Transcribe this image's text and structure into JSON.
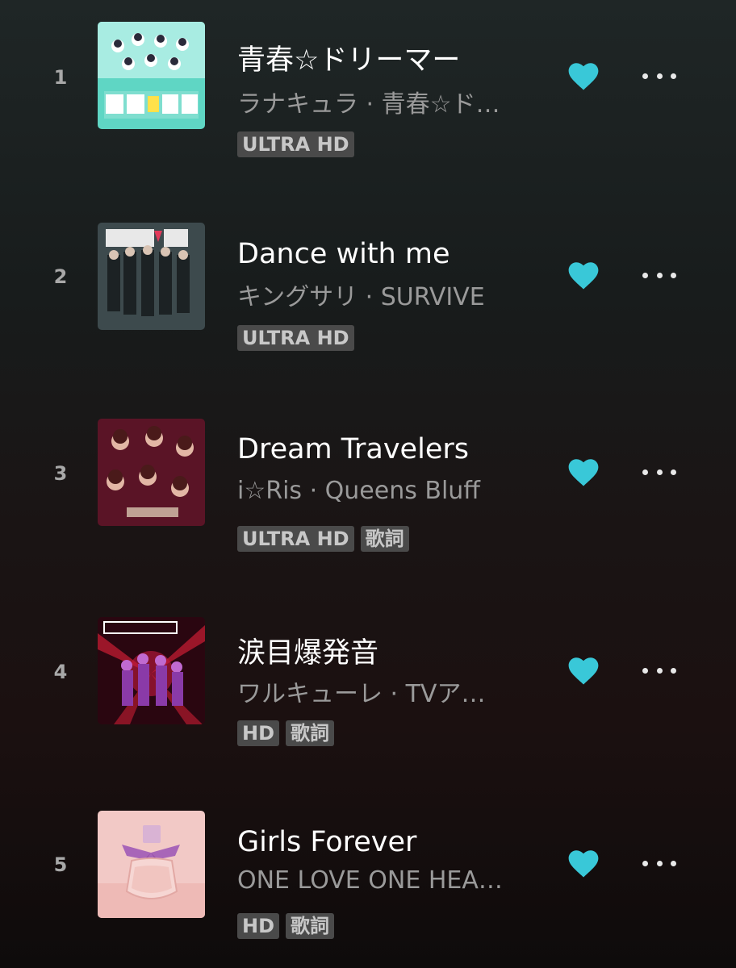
{
  "tracks": [
    {
      "number": "1",
      "title": "青春☆ドリーマー",
      "subtitle": "ラナキュラ · 青春☆ド…",
      "badges": [
        "ULTRA HD"
      ],
      "cover": "cover-art-seishun-dreamer",
      "liked": true
    },
    {
      "number": "2",
      "title": "Dance with me",
      "subtitle": "キングサリ · SURVIVE",
      "badges": [
        "ULTRA HD"
      ],
      "cover": "cover-art-survive",
      "liked": true
    },
    {
      "number": "3",
      "title": "Dream Travelers",
      "subtitle": "i☆Ris · Queens Bluff",
      "badges": [
        "ULTRA HD",
        "歌詞"
      ],
      "cover": "cover-art-queens-bluff",
      "liked": true
    },
    {
      "number": "4",
      "title": "涙目爆発音",
      "subtitle": "ワルキューレ · TVア…",
      "badges": [
        "HD",
        "歌詞"
      ],
      "cover": "cover-art-walkure",
      "liked": true
    },
    {
      "number": "5",
      "title": "Girls Forever",
      "subtitle": "ONE LOVE ONE HEA…",
      "badges": [
        "HD",
        "歌詞"
      ],
      "cover": "cover-art-girls-forever",
      "liked": true
    }
  ],
  "colors": {
    "heart": "#39c8d8",
    "badge_bg": "#4a4a4a",
    "badge_text": "#c8c8c8",
    "subtitle": "#9a9a9a",
    "number": "#a8a8a8"
  },
  "icons": {
    "like": "heart-icon",
    "more": "more-options-icon"
  }
}
